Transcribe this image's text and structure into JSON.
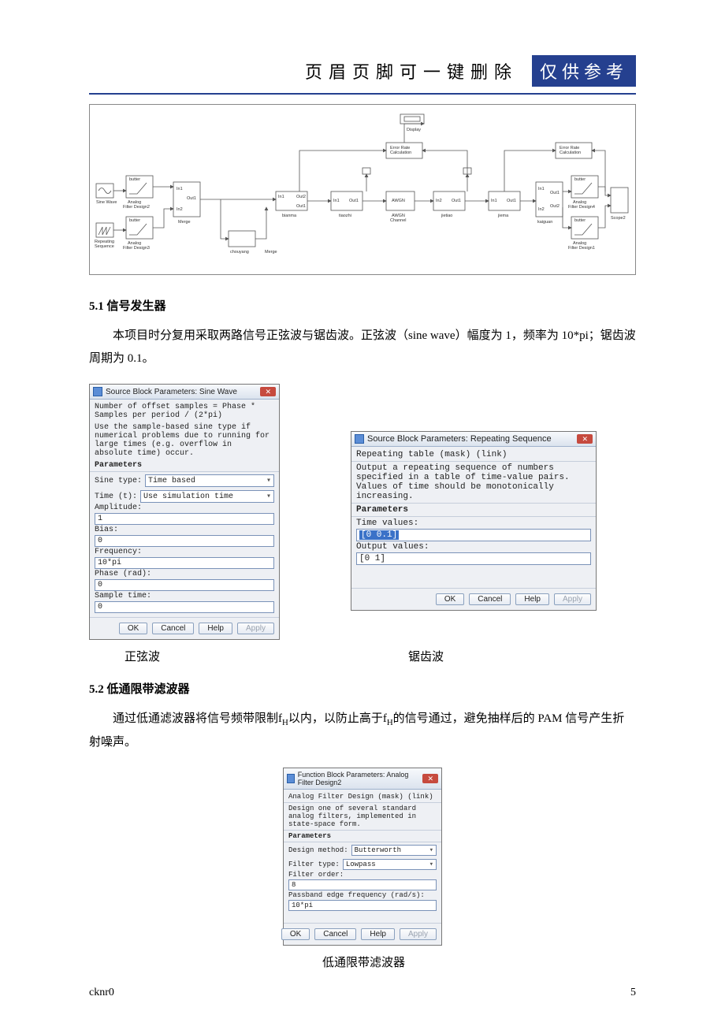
{
  "header": {
    "title": "页眉页脚可一键删除",
    "badge": "仅供参考"
  },
  "sec51": {
    "title": "5.1 信号发生器",
    "para": "本项目时分复用采取两路信号正弦波与锯齿波。正弦波（sine wave）幅度为 1，频率为 10*pi；锯齿波周期为 0.1。"
  },
  "sineDlg": {
    "title": "Source Block Parameters: Sine Wave",
    "l1": "Number of offset samples = Phase * Samples per period / (2*pi)",
    "l2": "Use the sample-based sine type if numerical problems due to running for large times (e.g. overflow in absolute time) occur.",
    "params": "Parameters",
    "sineType": "Sine type:",
    "sineTypeV": "Time based",
    "time": "Time (t):",
    "timeV": "Use simulation time",
    "amp": "Amplitude:",
    "ampV": "1",
    "bias": "Bias:",
    "biasV": "0",
    "freq": "Frequency:",
    "freqV": "10*pi",
    "phase": "Phase (rad):",
    "phaseV": "0",
    "st": "Sample time:",
    "stV": "0",
    "ok": "OK",
    "cancel": "Cancel",
    "help": "Help",
    "apply": "Apply"
  },
  "repDlg": {
    "title": "Source Block Parameters: Repeating Sequence",
    "mask": "Repeating table (mask) (link)",
    "desc": "Output a repeating sequence of numbers specified in a table of time-value pairs. Values of time should be monotonically increasing.",
    "params": "Parameters",
    "tv": "Time values:",
    "tvV": "[0 0.1]",
    "ov": "Output values:",
    "ovV": "[0 1]",
    "ok": "OK",
    "cancel": "Cancel",
    "help": "Help",
    "apply": "Apply"
  },
  "caps": {
    "sine": "正弦波",
    "saw": "锯齿波"
  },
  "sec52": {
    "title": "5.2 低通限带滤波器",
    "para": "通过低通滤波器将信号频带限制fH以内，以防止高于fH的信号通过，避免抽样后的 PAM 信号产生折射噪声。"
  },
  "filtDlg": {
    "title": "Function Block Parameters: Analog Filter Design2",
    "mask": "Analog Filter Design (mask) (link)",
    "desc": "Design one of several standard analog filters, implemented in state-space form.",
    "params": "Parameters",
    "dm": "Design method:",
    "dmV": "Butterworth",
    "ft": "Filter type:",
    "ftV": "Lowpass",
    "fo": "Filter order:",
    "foV": "8",
    "pb": "Passband edge frequency (rad/s):",
    "pbV": "10*pi",
    "ok": "OK",
    "cancel": "Cancel",
    "help": "Help",
    "apply": "Apply"
  },
  "filtCap": "低通限带滤波器",
  "footer": {
    "left": "cknr0",
    "right": "5"
  },
  "bd": {
    "display": "Display",
    "erc": "Error Rate\nCalculation",
    "sine": "Sine Wave",
    "rep": "Repeating\nSequence",
    "afd2": "Analog\nFilter Design2",
    "afd3": "Analog\nFilter Design3",
    "afd4": "Analog\nFilter Design4",
    "afd1": "Analog\nFilter Design1",
    "butter": "butter",
    "merge": "Merge",
    "chouyang": "chouyang",
    "bianma": "bianma",
    "tiaozhi": "tiaozhi",
    "awgn": "AWGN",
    "awgnc": "AWGN\nChannel",
    "jietiao": "jietiao",
    "jiema": "jiema",
    "kaiguan": "kaiguan",
    "scope": "Scope2",
    "in1": "In1",
    "in2": "In2",
    "out1": "Out1",
    "out2": "Out2"
  }
}
